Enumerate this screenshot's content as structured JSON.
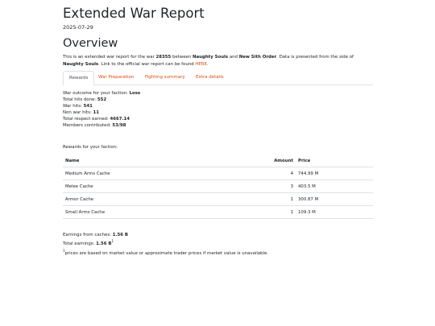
{
  "header": {
    "title": "Extended War Report",
    "date": "2025-07-29"
  },
  "overview": {
    "heading": "Overview",
    "intro_1": "This is an extended war report for the war ",
    "war_id": "28355",
    "intro_2": " between ",
    "faction_a": "Naughty Souls",
    "intro_3": " and ",
    "faction_b": "New Sith Order",
    "intro_4": ". Data is presented from the side of ",
    "side": "Naughty Souls",
    "intro_5": ". Link to the official war report can be found ",
    "link_label": "HERE",
    "intro_6": "."
  },
  "tabs": [
    {
      "label": "Rewards",
      "active": true
    },
    {
      "label": "War Preparation",
      "active": false
    },
    {
      "label": "Fighting summary",
      "active": false
    },
    {
      "label": "Extra details",
      "active": false
    }
  ],
  "stats": [
    {
      "label": "War outcome for your faction: ",
      "value": "Loss"
    },
    {
      "label": "Total hits done: ",
      "value": "552"
    },
    {
      "label": "War hits: ",
      "value": "541"
    },
    {
      "label": "Non war hits: ",
      "value": "11"
    },
    {
      "label": "Total respect earned: ",
      "value": "4667.14"
    },
    {
      "label": "Members contributed: ",
      "value": "53/98"
    }
  ],
  "rewards": {
    "label": "Rewards for your faction:",
    "headers": {
      "name": "Name",
      "amount": "Amount",
      "price": "Price"
    },
    "rows": [
      {
        "name": "Medium Arms Cache",
        "amount": "4",
        "price": "744.99 M"
      },
      {
        "name": "Melee Cache",
        "amount": "3",
        "price": "403.5 M"
      },
      {
        "name": "Armor Cache",
        "amount": "1",
        "price": "300.87 M"
      },
      {
        "name": "Small Arms Cache",
        "amount": "1",
        "price": "109.3 M"
      }
    ]
  },
  "earnings": {
    "caches_label": "Earnings from caches: ",
    "caches_value": "1.56 B",
    "total_label": "Total earnings: ",
    "total_value": "1.56 B",
    "total_marker": "1"
  },
  "footnote": {
    "marker": "1",
    "text": "prices are based on market value or approximate trader prices if market value is unavailable."
  }
}
